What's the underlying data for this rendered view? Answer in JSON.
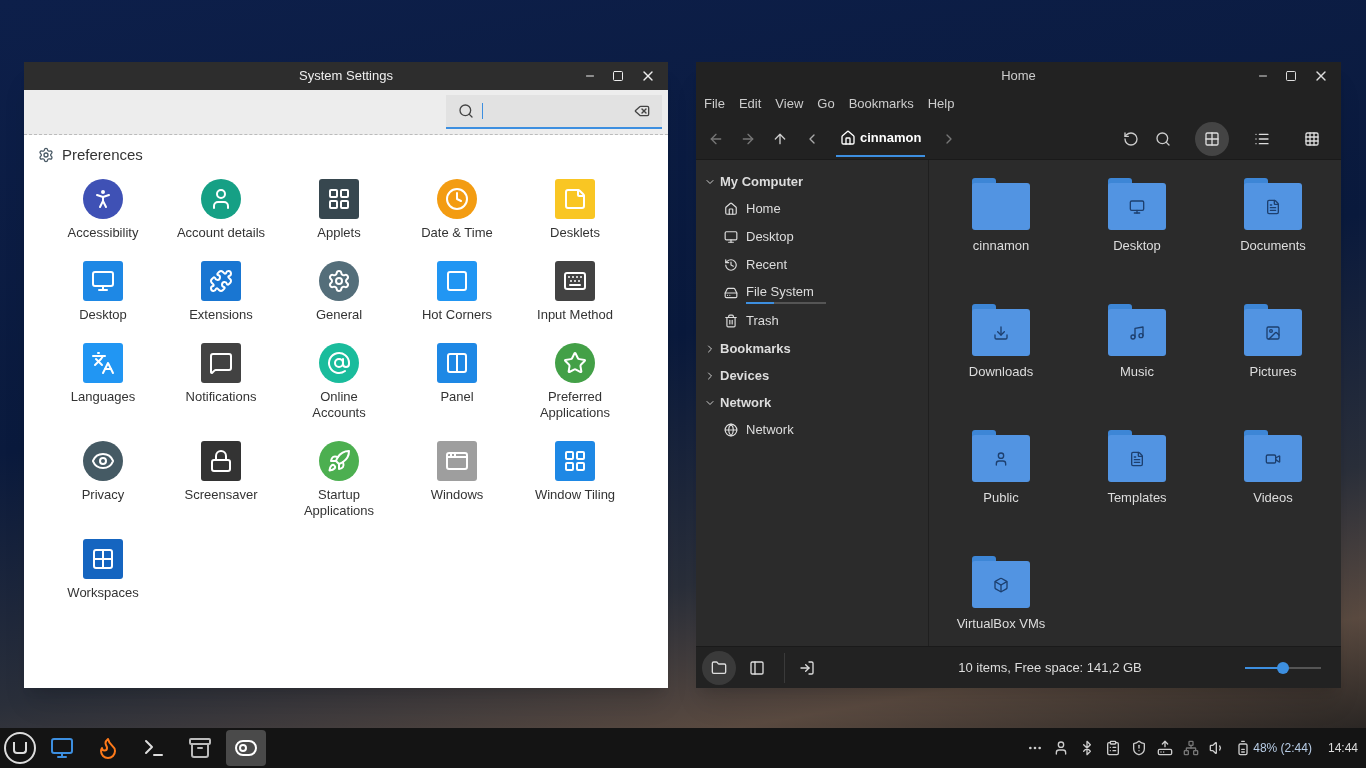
{
  "settings_window": {
    "title": "System Settings",
    "search": {
      "focused": true
    },
    "section": "Preferences",
    "items": [
      {
        "label": "Accessibility"
      },
      {
        "label": "Account details"
      },
      {
        "label": "Applets"
      },
      {
        "label": "Date & Time"
      },
      {
        "label": "Desklets"
      },
      {
        "label": "Desktop"
      },
      {
        "label": "Extensions"
      },
      {
        "label": "General"
      },
      {
        "label": "Hot Corners"
      },
      {
        "label": "Input Method"
      },
      {
        "label": "Languages"
      },
      {
        "label": "Notifications"
      },
      {
        "label": "Online\nAccounts"
      },
      {
        "label": "Panel"
      },
      {
        "label": "Preferred\nApplications"
      },
      {
        "label": "Privacy"
      },
      {
        "label": "Screensaver"
      },
      {
        "label": "Startup\nApplications"
      },
      {
        "label": "Windows"
      },
      {
        "label": "Window Tiling"
      },
      {
        "label": "Workspaces"
      }
    ]
  },
  "files_window": {
    "title": "Home",
    "menu": [
      "File",
      "Edit",
      "View",
      "Go",
      "Bookmarks",
      "Help"
    ],
    "breadcrumb": "cinnamon",
    "view_buttons": [
      {
        "kind": "icons",
        "selected": true
      },
      {
        "kind": "list",
        "selected": false
      },
      {
        "kind": "compact",
        "selected": false
      }
    ],
    "sidebar": [
      {
        "label": "My Computer",
        "expanded": true,
        "children": [
          {
            "label": "Home",
            "kind": "home"
          },
          {
            "label": "Desktop",
            "kind": "desktop"
          },
          {
            "label": "Recent",
            "kind": "recent"
          },
          {
            "label": "File System",
            "kind": "disk",
            "level": 0.35
          },
          {
            "label": "Trash",
            "kind": "trash"
          }
        ]
      },
      {
        "label": "Bookmarks",
        "expanded": false
      },
      {
        "label": "Devices",
        "expanded": false
      },
      {
        "label": "Network",
        "expanded": true,
        "children": [
          {
            "label": "Network",
            "kind": "network"
          }
        ]
      }
    ],
    "files": [
      {
        "name": "cinnamon"
      },
      {
        "name": "Desktop"
      },
      {
        "name": "Documents"
      },
      {
        "name": "Downloads"
      },
      {
        "name": "Music"
      },
      {
        "name": "Pictures"
      },
      {
        "name": "Public"
      },
      {
        "name": "Templates"
      },
      {
        "name": "Videos"
      },
      {
        "name": "VirtualBox VMs"
      }
    ],
    "pane_buttons": [
      {
        "kind": "places",
        "selected": true
      },
      {
        "kind": "tree",
        "selected": false
      }
    ],
    "status": "10 items, Free space: 141,2 GB",
    "zoom": {
      "level": 0.5
    }
  },
  "taskbar": {
    "apps": [
      {
        "kind": "files",
        "active": false
      },
      {
        "kind": "browser",
        "active": false
      },
      {
        "kind": "terminal",
        "active": false
      },
      {
        "kind": "manager",
        "active": false
      },
      {
        "kind": "settings",
        "active": true
      }
    ],
    "battery": "48% (2:44)",
    "clock": "14:44"
  }
}
